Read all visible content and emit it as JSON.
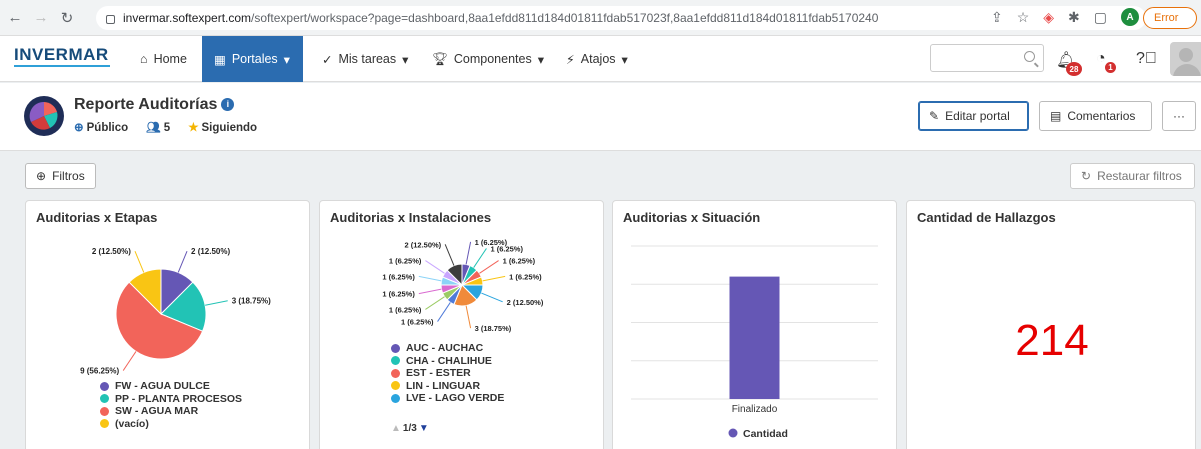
{
  "browser": {
    "url_host": "invermar.softexpert.com",
    "url_path": "/softexpert/workspace?page=dashboard,8aa1efdd811d184d01811fdab517023f,8aa1efdd811d184d01811fdab5170240",
    "profile_initial": "A",
    "error_label": "Error"
  },
  "nav": {
    "logo": "INVERMAR",
    "items": [
      {
        "label": "Home"
      },
      {
        "label": "Portales"
      },
      {
        "label": "Mis tareas"
      },
      {
        "label": "Componentes"
      },
      {
        "label": "Atajos"
      }
    ],
    "notifications_count": "28",
    "alerts_count": "1",
    "brand_color": "#2b6cb0"
  },
  "portal": {
    "title": "Reporte Auditorías",
    "visibility": "Público",
    "followers": "5",
    "following_label": "Siguiendo",
    "edit_button": "Editar portal",
    "comments_button": "Comentarios",
    "more_button": "···"
  },
  "toolbar": {
    "filters_label": "Filtros",
    "restore_label": "Restaurar filtros"
  },
  "cards": {
    "etapas": {
      "title": "Auditorias x Etapas"
    },
    "instalaciones": {
      "title": "Auditorias x Instalaciones",
      "pager": "1/3"
    },
    "situacion": {
      "title": "Auditorias x Situación"
    },
    "hallazgos": {
      "title": "Cantidad de Hallazgos",
      "value": "214"
    }
  },
  "chart_data": [
    {
      "type": "pie",
      "title": "Auditorias x Etapas",
      "slices": [
        {
          "label": "FW - AGUA DULCE",
          "value": 2,
          "text": "2 (12.50%)",
          "color": "#6557b5"
        },
        {
          "label": "PP - PLANTA PROCESOS",
          "value": 3,
          "text": "3 (18.75%)",
          "color": "#22c3b5"
        },
        {
          "label": "SW - AGUA MAR",
          "value": 9,
          "text": "9 (56.25%)",
          "color": "#f2645a"
        },
        {
          "label": "(vacío)",
          "value": 2,
          "text": "2 (12.50%)",
          "color": "#f9c514"
        }
      ],
      "legend": "bottom"
    },
    {
      "type": "pie",
      "title": "Auditorias x Instalaciones",
      "slices": [
        {
          "label": "AUC - AUCHAC",
          "value": 1,
          "text": "1 (6.25%)",
          "color": "#6557b5"
        },
        {
          "label": "CHA - CHALIHUE",
          "value": 1,
          "text": "1 (6.25%)",
          "color": "#22c3b5"
        },
        {
          "label": "EST - ESTER",
          "value": 1,
          "text": "1 (6.25%)",
          "color": "#f2645a"
        },
        {
          "label": "LIN - LINGUAR",
          "value": 1,
          "text": "1 (6.25%)",
          "color": "#f9c514"
        },
        {
          "label": "LVE - LAGO VERDE",
          "value": 2,
          "text": "2 (12.50%)",
          "color": "#2aa4de"
        },
        {
          "label": "",
          "value": 3,
          "text": "3 (18.75%)",
          "color": "#f08a3a"
        },
        {
          "label": "",
          "value": 1,
          "text": "1 (6.25%)",
          "color": "#4f7bd9"
        },
        {
          "label": "",
          "value": 1,
          "text": "1 (6.25%)",
          "color": "#9ccc65"
        },
        {
          "label": "",
          "value": 1,
          "text": "1 (6.25%)",
          "color": "#d96ad0"
        },
        {
          "label": "",
          "value": 1,
          "text": "1 (6.25%)",
          "color": "#8bd3f7"
        },
        {
          "label": "",
          "value": 1,
          "text": "1 (6.25%)",
          "color": "#c9a6ff"
        },
        {
          "label": "",
          "value": 2,
          "text": "2 (12.50%)",
          "color": "#3d3d3d"
        }
      ],
      "legend": "bottom"
    },
    {
      "type": "bar",
      "title": "Auditorias x Situación",
      "categories": [
        "Finalizado"
      ],
      "series": [
        {
          "name": "Cantidad",
          "values": [
            16
          ],
          "color": "#6557b5"
        }
      ],
      "ylim": [
        0,
        20
      ],
      "grid": true,
      "legend": "bottom"
    }
  ]
}
